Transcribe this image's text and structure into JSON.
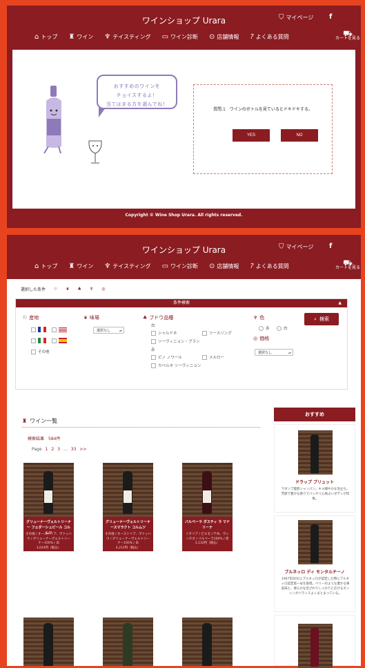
{
  "header": {
    "shop_name": "ワインショップ Urara",
    "mypage_label": "マイページ",
    "facebook_label": "f",
    "nav": [
      {
        "label": "トップ",
        "icon": "shop-icon"
      },
      {
        "label": "ワイン",
        "icon": "wine-bottle-glass-icon"
      },
      {
        "label": "テイスティング",
        "icon": "wine-glasses-icon"
      },
      {
        "label": "ワイン診断",
        "icon": "monitor-icon"
      },
      {
        "label": "店舗情報",
        "icon": "map-pin-icon"
      },
      {
        "label": "よくある質問",
        "icon": "question-icon"
      }
    ],
    "cart_label": "カートを見る"
  },
  "quiz": {
    "bubble_line1": "おすすめのワインを",
    "bubble_line2": "チョイスするよ！",
    "bubble_line3": "当てはまる方を選んでね！",
    "question": "質問.1　ワインのボトルを見ているとドキドキする。",
    "yes_label": "YES",
    "no_label": "NO"
  },
  "footer": {
    "copyright": "Copyright © Wine Shop Urara. All rights reserved."
  },
  "search": {
    "selected_label": "選択した条件",
    "panel_title": "条件検索",
    "origin_label": "産地",
    "origin_other": "その他",
    "taste_label": "味場",
    "taste_select": "選択なし",
    "grape_label": "ブドウ品種",
    "white_label": "白",
    "red_label": "赤",
    "grapes_white": [
      "シャルドネ",
      "リースリング",
      "ソーヴィニョン・ブラン"
    ],
    "grapes_red": [
      "ピノ ノワール",
      "メルロー",
      "カベルネ ソーヴィニョン"
    ],
    "color_label": "色",
    "color_red": "赤",
    "color_white": "白",
    "price_label": "価格",
    "price_select": "選択なし",
    "search_button": "検索",
    "colors": {
      "accent": "#8a1c22",
      "background": "#e8431f"
    }
  },
  "list": {
    "title": "ワイン一覧",
    "count": "検索結果　584件",
    "page_label": "Page",
    "pages": [
      "1",
      "2",
      "3",
      "...",
      "33",
      ">>"
    ],
    "cards": [
      {
        "name": "グリューナーヴェルトリーナー フェダーシュピール コルムツ",
        "desc": "その他 / オーストリア、ヴァッハウ / グリューナーヴェルトリーナー100% / 白",
        "price": "3,024円（税込）"
      },
      {
        "name": "グリューナーヴェルトリーナースマラクト コルムツ",
        "desc": "その他 / オーストリア、ヴァッハウ / グリューナーヴェルトリーナー100% / 白",
        "price": "4,212円（税込）"
      },
      {
        "name": "バルベーラ ダスティ ラ マドリーナ",
        "desc": "イタリア / ピエモンテ州、ヴィンチオ / バルベーラ100% / 赤",
        "price": "3,132円（税込）"
      }
    ]
  },
  "sidebar": {
    "title": "おすすめ",
    "items": [
      {
        "name": "ドラップ ブリュット",
        "desc": "マダンブ愛飲シャンパン。キメ細やかな泡立ち。芳醇で豊かな香りでバッチリ心地よいボディが印象。"
      },
      {
        "name": "ブルネッロ ディ モンタルチーノ",
        "desc": "1967年DOCにブルネッロが認定した際にブルネッロ認定第一号を取得。ベリーのような豊かな果実味と、滑らかな舌ざわりしっかりと広がるタンニンがバランスよくまとまっている。"
      }
    ]
  }
}
